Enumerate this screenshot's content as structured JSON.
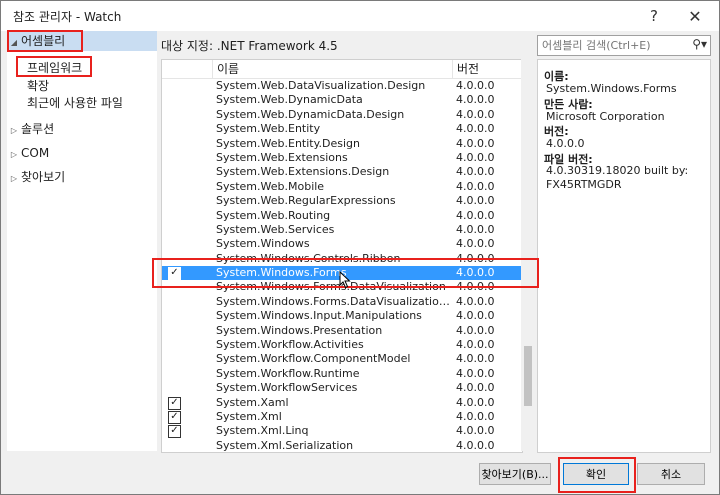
{
  "window": {
    "title": "참조 관리자 - Watch",
    "help": "?",
    "close": "✕"
  },
  "nav": {
    "assemblies": "어셈블리",
    "framework": "프레임워크",
    "extensions": "확장",
    "recent": "최근에 사용한 파일",
    "solution": "솔루션",
    "com": "COM",
    "browse": "찾아보기"
  },
  "target": "대상 지정: .NET Framework 4.5",
  "search": {
    "placeholder": "어셈블리 검색(Ctrl+E)"
  },
  "columns": {
    "name": "이름",
    "version": "버전"
  },
  "rows": [
    {
      "name": "System.Web.DataVisualization.Design",
      "version": "4.0.0.0",
      "checked": false
    },
    {
      "name": "System.Web.DynamicData",
      "version": "4.0.0.0",
      "checked": false
    },
    {
      "name": "System.Web.DynamicData.Design",
      "version": "4.0.0.0",
      "checked": false
    },
    {
      "name": "System.Web.Entity",
      "version": "4.0.0.0",
      "checked": false
    },
    {
      "name": "System.Web.Entity.Design",
      "version": "4.0.0.0",
      "checked": false
    },
    {
      "name": "System.Web.Extensions",
      "version": "4.0.0.0",
      "checked": false
    },
    {
      "name": "System.Web.Extensions.Design",
      "version": "4.0.0.0",
      "checked": false
    },
    {
      "name": "System.Web.Mobile",
      "version": "4.0.0.0",
      "checked": false
    },
    {
      "name": "System.Web.RegularExpressions",
      "version": "4.0.0.0",
      "checked": false
    },
    {
      "name": "System.Web.Routing",
      "version": "4.0.0.0",
      "checked": false
    },
    {
      "name": "System.Web.Services",
      "version": "4.0.0.0",
      "checked": false
    },
    {
      "name": "System.Windows",
      "version": "4.0.0.0",
      "checked": false
    },
    {
      "name": "System.Windows.Controls.Ribbon",
      "version": "4.0.0.0",
      "checked": false
    },
    {
      "name": "System.Windows.Forms",
      "version": "4.0.0.0",
      "checked": true,
      "selected": true
    },
    {
      "name": "System.Windows.Forms.DataVisualization",
      "version": "4.0.0.0",
      "checked": false
    },
    {
      "name": "System.Windows.Forms.DataVisualization.Des...",
      "version": "4.0.0.0",
      "checked": false
    },
    {
      "name": "System.Windows.Input.Manipulations",
      "version": "4.0.0.0",
      "checked": false
    },
    {
      "name": "System.Windows.Presentation",
      "version": "4.0.0.0",
      "checked": false
    },
    {
      "name": "System.Workflow.Activities",
      "version": "4.0.0.0",
      "checked": false
    },
    {
      "name": "System.Workflow.ComponentModel",
      "version": "4.0.0.0",
      "checked": false
    },
    {
      "name": "System.Workflow.Runtime",
      "version": "4.0.0.0",
      "checked": false
    },
    {
      "name": "System.WorkflowServices",
      "version": "4.0.0.0",
      "checked": false
    },
    {
      "name": "System.Xaml",
      "version": "4.0.0.0",
      "checked": true
    },
    {
      "name": "System.Xml",
      "version": "4.0.0.0",
      "checked": true
    },
    {
      "name": "System.Xml.Linq",
      "version": "4.0.0.0",
      "checked": true
    },
    {
      "name": "System.Xml.Serialization",
      "version": "4.0.0.0",
      "checked": false
    }
  ],
  "details": {
    "name_label": "이름:",
    "name_value": "System.Windows.Forms",
    "author_label": "만든 사람:",
    "author_value": "Microsoft Corporation",
    "version_label": "버전:",
    "version_value": "4.0.0.0",
    "fileversion_label": "파일 버전:",
    "fileversion_value1": "4.0.30319.18020 built by:",
    "fileversion_value2": "FX45RTMGDR"
  },
  "buttons": {
    "browse": "찾아보기(B)...",
    "ok": "확인",
    "cancel": "취소"
  },
  "accent": {
    "selection": "#3399ff",
    "highlight": "#e8211d",
    "nav_selected": "#c9ddf2"
  }
}
